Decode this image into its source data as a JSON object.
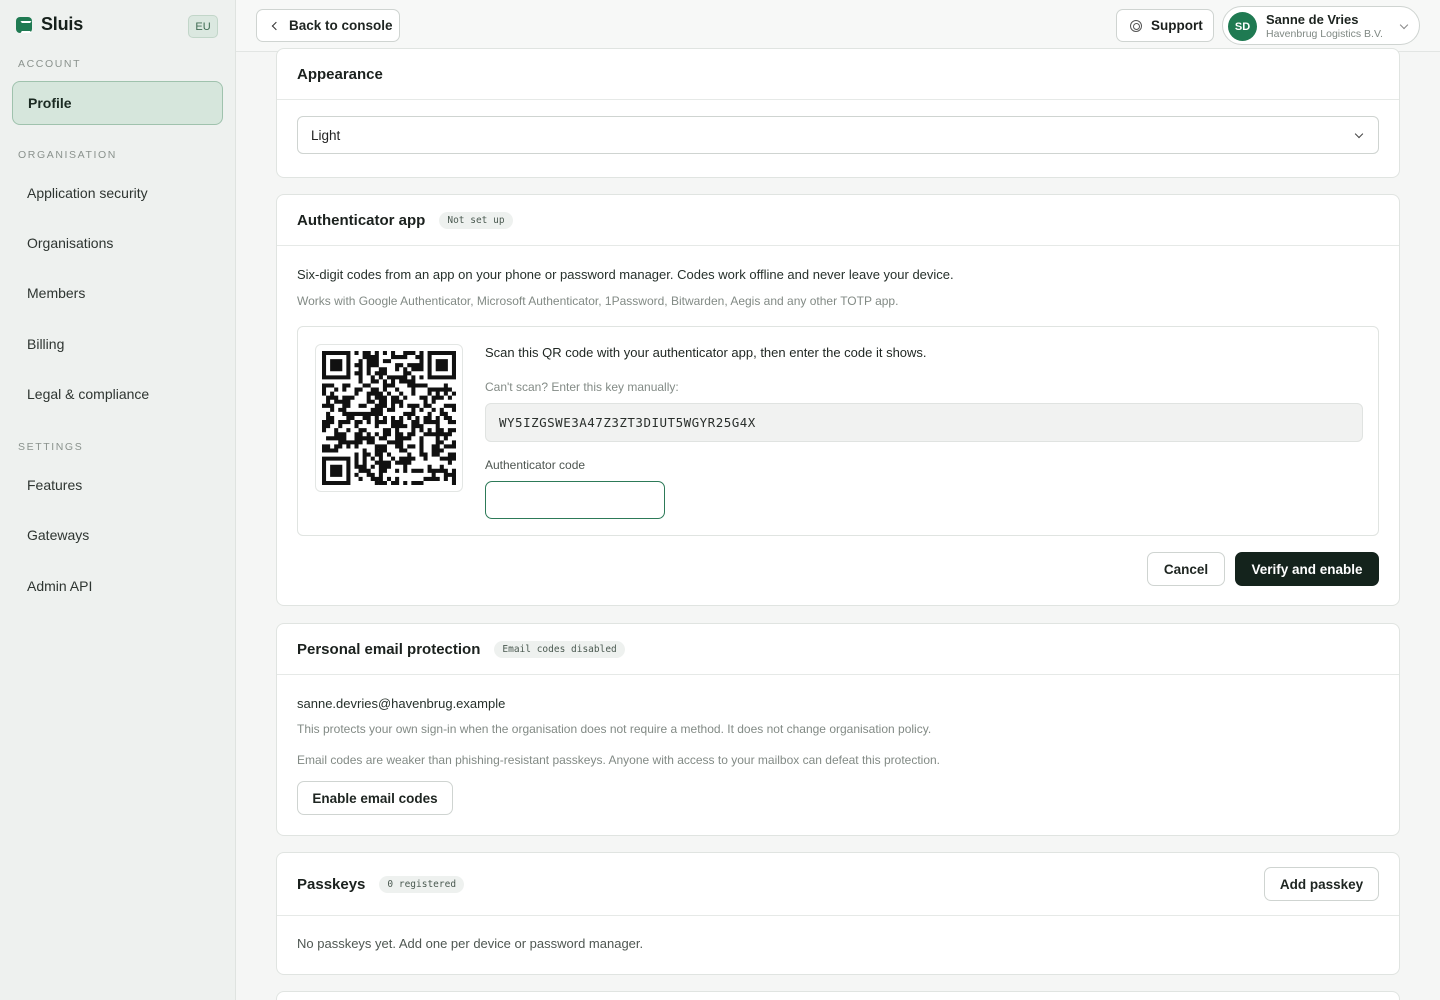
{
  "app": {
    "name": "Sluis",
    "region": "EU"
  },
  "sidebar": {
    "sections": [
      {
        "label": "ACCOUNT",
        "items": [
          {
            "label": "Profile",
            "active": true
          }
        ]
      },
      {
        "label": "ORGANISATION",
        "items": [
          {
            "label": "Application security"
          },
          {
            "label": "Organisations"
          },
          {
            "label": "Members"
          },
          {
            "label": "Billing"
          },
          {
            "label": "Legal & compliance"
          }
        ]
      },
      {
        "label": "SETTINGS",
        "items": [
          {
            "label": "Features"
          },
          {
            "label": "Gateways"
          },
          {
            "label": "Admin API"
          }
        ]
      }
    ]
  },
  "topbar": {
    "back_label": "Back to console",
    "support_label": "Support",
    "user": {
      "initials": "SD",
      "name": "Sanne de Vries",
      "org": "Havenbrug Logistics B.V."
    }
  },
  "appearance": {
    "title": "Appearance",
    "value": "Light"
  },
  "authenticator": {
    "title": "Authenticator app",
    "status": "Not set up",
    "description": "Six-digit codes from an app on your phone or password manager. Codes work offline and never leave your device.",
    "compat": "Works with Google Authenticator, Microsoft Authenticator, 1Password, Bitwarden, Aegis and any other TOTP app.",
    "scan_text": "Scan this QR code with your authenticator app, then enter the code it shows.",
    "key_label": "Can't scan? Enter this key manually:",
    "key": "WY5IZGSWE3A47Z3ZT3DIUT5WGYR25G4X",
    "code_label": "Authenticator code",
    "code_value": "",
    "cancel_label": "Cancel",
    "verify_label": "Verify and enable"
  },
  "email_protection": {
    "title": "Personal email protection",
    "status": "Email codes disabled",
    "email": "sanne.devries@havenbrug.example",
    "note1": "This protects your own sign-in when the organisation does not require a method. It does not change organisation policy.",
    "note2": "Email codes are weaker than phishing-resistant passkeys. Anyone with access to your mailbox can defeat this protection.",
    "enable_label": "Enable email codes"
  },
  "passkeys": {
    "title": "Passkeys",
    "status": "0 registered",
    "add_label": "Add passkey",
    "empty_text": "No passkeys yet. Add one per device or password manager."
  },
  "colors": {
    "accent": "#1f7a52",
    "dark_button": "#14231c",
    "sidebar_bg": "#eef1ef"
  },
  "icons": [
    "chevron-left-icon",
    "lifebuoy-icon",
    "chevron-down-icon",
    "app-logo-icon"
  ]
}
